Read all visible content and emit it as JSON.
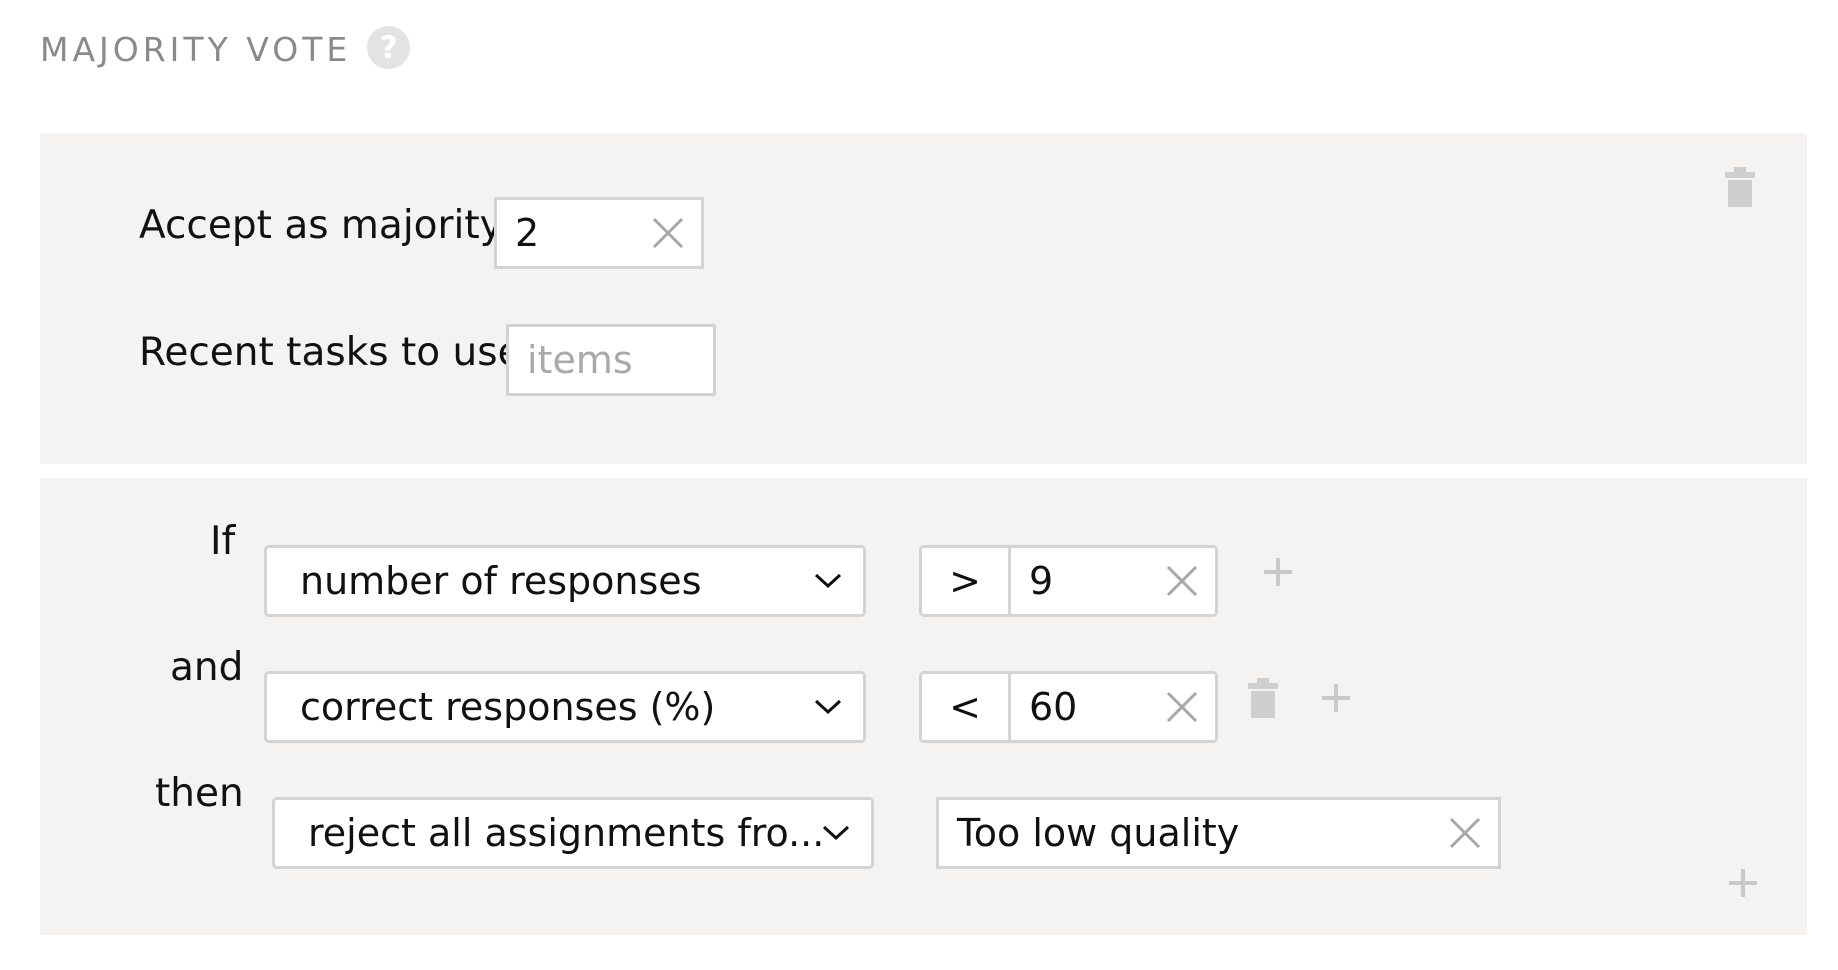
{
  "header": {
    "title": "MAJORITY VOTE",
    "help_icon": "question-icon",
    "help_glyph": "?"
  },
  "settings": {
    "accept_label": "Accept as majority",
    "accept_value": "2",
    "recent_label": "Recent tasks to use",
    "recent_value": "",
    "recent_placeholder": "items"
  },
  "rules": {
    "if_label": "If",
    "and_label": "and",
    "then_label": "then",
    "condition1": {
      "field": "number of responses",
      "operator": ">",
      "value": "9"
    },
    "condition2": {
      "field": "correct responses (%)",
      "operator": "<",
      "value": "60"
    },
    "action": {
      "field": "reject all assignments fro...",
      "comment": "Too low quality"
    }
  },
  "colors": {
    "panel_bg": "#f4f3f2",
    "border": "#d3d3d3",
    "icon_muted": "#c9c9c9",
    "title_gray": "#8a8a8a"
  }
}
